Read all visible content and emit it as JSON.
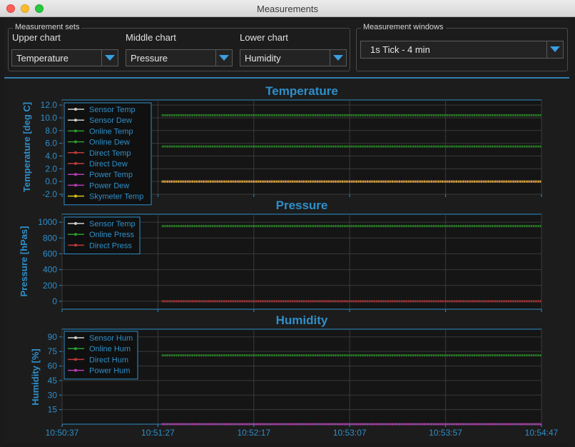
{
  "window": {
    "title": "Measurements"
  },
  "measurement_sets": {
    "title": "Measurement sets",
    "upper": {
      "label": "Upper chart",
      "value": "Temperature"
    },
    "middle": {
      "label": "Middle chart",
      "value": "Pressure"
    },
    "lower": {
      "label": "Lower chart",
      "value": "Humidity"
    }
  },
  "measurement_windows": {
    "title": "Measurement windows",
    "value": "1s Tick  -  4 min"
  },
  "icons": {
    "dropdown": "chevron-down-icon",
    "close": "close-icon",
    "minimize": "minimize-icon",
    "maximize": "maximize-icon"
  },
  "colors": {
    "accent": "#2f8fc9",
    "sensor_temp": "#cfcfcf",
    "sensor_dew": "#cfcfcf",
    "online": "#2e9b2e",
    "direct": "#c23a3a",
    "power": "#b63db6",
    "skymeter": "#d9c21a"
  },
  "chart_data": [
    {
      "type": "line",
      "title": "Temperature",
      "ylabel": "Temperature [deg C]",
      "ylim": [
        -2.0,
        12.8
      ],
      "yticks": [
        "12.0",
        "10.0",
        "8.0",
        "6.0",
        "4.0",
        "2.0",
        "0.0",
        "-2.0"
      ],
      "ytick_values": [
        12,
        10,
        8,
        6,
        4,
        2,
        0,
        -2
      ],
      "x": [
        "10:51:29",
        "10:54:47"
      ],
      "series": [
        {
          "name": "Sensor Temp",
          "color": "#cfcfcf",
          "values": []
        },
        {
          "name": "Sensor Dew",
          "color": "#cfcfcf",
          "values": []
        },
        {
          "name": "Online Temp",
          "color": "#2e9b2e",
          "values": [
            10.4,
            10.4
          ]
        },
        {
          "name": "Online Dew",
          "color": "#2e9b2e",
          "values": [
            5.5,
            5.5
          ]
        },
        {
          "name": "Direct Temp",
          "color": "#c23a3a",
          "values": [
            0.0,
            0.0
          ]
        },
        {
          "name": "Direct Dew",
          "color": "#c23a3a",
          "values": [
            0.0,
            0.0
          ]
        },
        {
          "name": "Power Temp",
          "color": "#b63db6",
          "values": [
            0.0,
            0.0
          ]
        },
        {
          "name": "Power Dew",
          "color": "#b63db6",
          "values": [
            0.0,
            0.0
          ]
        },
        {
          "name": "Skymeter Temp",
          "color": "#d9c21a",
          "values": [
            0.0,
            0.0
          ]
        }
      ],
      "legend": "top-left",
      "grid": true
    },
    {
      "type": "line",
      "title": "Pressure",
      "ylabel": "Pressure [hPas]",
      "ylim": [
        -100,
        1100
      ],
      "yticks": [
        "1000",
        "800",
        "600",
        "400",
        "200",
        "0"
      ],
      "ytick_values": [
        1000,
        800,
        600,
        400,
        200,
        0
      ],
      "x": [
        "10:51:29",
        "10:54:47"
      ],
      "series": [
        {
          "name": "Sensor Temp",
          "color": "#cfcfcf",
          "values": []
        },
        {
          "name": "Online Press",
          "color": "#2e9b2e",
          "values": [
            950,
            950
          ]
        },
        {
          "name": "Direct Press",
          "color": "#c23a3a",
          "values": [
            0,
            0
          ]
        }
      ],
      "legend": "top-left",
      "grid": true
    },
    {
      "type": "line",
      "title": "Humidity",
      "ylabel": "Humidity [%]",
      "ylim": [
        0,
        98
      ],
      "yticks": [
        "90",
        "75",
        "60",
        "45",
        "30",
        "15"
      ],
      "ytick_values": [
        90,
        75,
        60,
        45,
        30,
        15
      ],
      "x": [
        "10:51:29",
        "10:54:47"
      ],
      "series": [
        {
          "name": "Sensor Hum",
          "color": "#cfcfcf",
          "values": []
        },
        {
          "name": "Online Hum",
          "color": "#2e9b2e",
          "values": [
            71,
            71
          ]
        },
        {
          "name": "Direct Hum",
          "color": "#c23a3a",
          "values": [
            0,
            0
          ]
        },
        {
          "name": "Power Hum",
          "color": "#b63db6",
          "values": [
            0,
            0
          ]
        }
      ],
      "legend": "top-left",
      "grid": true
    }
  ],
  "x_axis": {
    "range": [
      "10:50:37",
      "10:54:47"
    ],
    "ticks": [
      "10:50:37",
      "10:51:27",
      "10:52:17",
      "10:53:07",
      "10:53:57",
      "10:54:47"
    ]
  }
}
